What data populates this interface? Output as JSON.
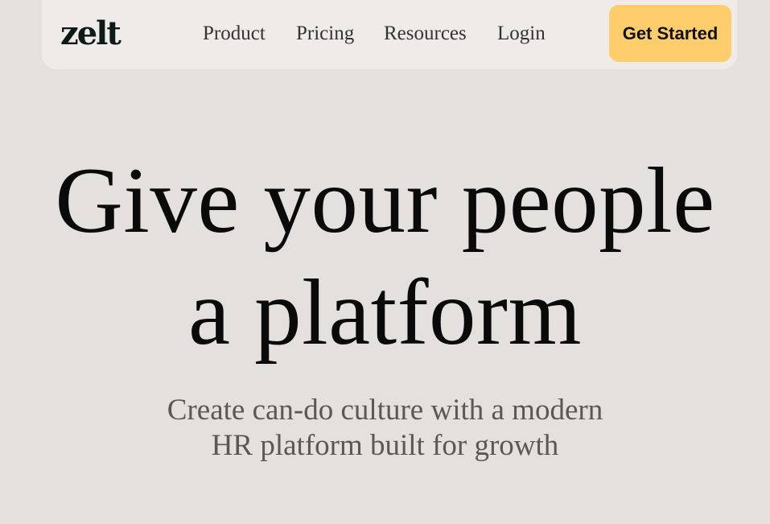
{
  "brand": {
    "logo_text": "zelt"
  },
  "nav": {
    "links": [
      "Product",
      "Pricing",
      "Resources",
      "Login"
    ],
    "cta_label": "Get Started"
  },
  "hero": {
    "title_line1": "Give your people",
    "title_line2": "a platform",
    "subtitle_line1": "Create can-do culture with a modern",
    "subtitle_line2": "HR platform built for growth"
  },
  "colors": {
    "page_background": "#e3e0dd",
    "navbar_background": "#eeebe8",
    "cta_background": "#ffcd6b",
    "subtitle_text": "#5a5755"
  }
}
